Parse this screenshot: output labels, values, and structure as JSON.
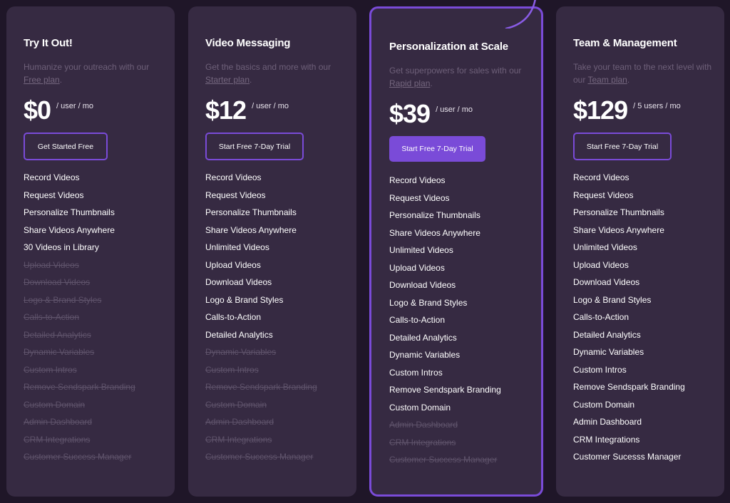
{
  "colors": {
    "background": "#1f1628",
    "card": "#362a42",
    "accent": "#7a4bd8",
    "muted_text": "#6e6079",
    "disabled_text": "#5f536b"
  },
  "plans": [
    {
      "title": "Try It Out!",
      "desc_prefix": "Humanize your outreach with our ",
      "link": "Free plan",
      "desc_suffix": ".",
      "price": "$0",
      "unit": "/ user / mo",
      "button": "Get Started Free",
      "highlighted": false,
      "features": [
        {
          "label": "Record Videos",
          "included": true
        },
        {
          "label": "Request Videos",
          "included": true
        },
        {
          "label": "Personalize Thumbnails",
          "included": true
        },
        {
          "label": "Share Videos Anywhere",
          "included": true
        },
        {
          "label": "30 Videos in Library",
          "included": true
        },
        {
          "label": "Upload Videos",
          "included": false
        },
        {
          "label": "Download Videos",
          "included": false
        },
        {
          "label": "Logo & Brand Styles",
          "included": false
        },
        {
          "label": "Calls-to-Action",
          "included": false
        },
        {
          "label": "Detailed Analytics",
          "included": false
        },
        {
          "label": "Dynamic Variables",
          "included": false
        },
        {
          "label": "Custom Intros",
          "included": false
        },
        {
          "label": "Remove Sendspark Branding",
          "included": false
        },
        {
          "label": "Custom Domain",
          "included": false
        },
        {
          "label": "Admin Dashboard",
          "included": false
        },
        {
          "label": "CRM Integrations",
          "included": false
        },
        {
          "label": "Customer Success Manager",
          "included": false
        }
      ]
    },
    {
      "title": "Video Messaging",
      "desc_prefix": "Get the basics and more with our ",
      "link": "Starter plan",
      "desc_suffix": ".",
      "price": "$12",
      "unit": "/ user / mo",
      "button": "Start Free 7-Day Trial",
      "highlighted": false,
      "features": [
        {
          "label": "Record Videos",
          "included": true
        },
        {
          "label": "Request Videos",
          "included": true
        },
        {
          "label": "Personalize Thumbnails",
          "included": true
        },
        {
          "label": "Share Videos Anywhere",
          "included": true
        },
        {
          "label": "Unlimited Videos",
          "included": true
        },
        {
          "label": "Upload Videos",
          "included": true
        },
        {
          "label": "Download Videos",
          "included": true
        },
        {
          "label": "Logo & Brand Styles",
          "included": true
        },
        {
          "label": "Calls-to-Action",
          "included": true
        },
        {
          "label": "Detailed Analytics",
          "included": true
        },
        {
          "label": "Dynamic Variables",
          "included": false
        },
        {
          "label": "Custom Intros",
          "included": false
        },
        {
          "label": "Remove Sendspark Branding",
          "included": false
        },
        {
          "label": "Custom Domain",
          "included": false
        },
        {
          "label": "Admin Dashboard",
          "included": false
        },
        {
          "label": "CRM Integrations",
          "included": false
        },
        {
          "label": "Customer Success Manager",
          "included": false
        }
      ]
    },
    {
      "title": "Personalization at Scale",
      "desc_prefix": "Get superpowers for sales with our ",
      "link": "Rapid plan",
      "desc_suffix": ".",
      "price": "$39",
      "unit": "/ user / mo",
      "button": "Start Free 7-Day Trial",
      "highlighted": true,
      "features": [
        {
          "label": "Record Videos",
          "included": true
        },
        {
          "label": "Request Videos",
          "included": true
        },
        {
          "label": "Personalize Thumbnails",
          "included": true
        },
        {
          "label": "Share Videos Anywhere",
          "included": true
        },
        {
          "label": "Unlimited Videos",
          "included": true
        },
        {
          "label": "Upload Videos",
          "included": true
        },
        {
          "label": "Download Videos",
          "included": true
        },
        {
          "label": "Logo & Brand Styles",
          "included": true
        },
        {
          "label": "Calls-to-Action",
          "included": true
        },
        {
          "label": "Detailed Analytics",
          "included": true
        },
        {
          "label": "Dynamic Variables",
          "included": true
        },
        {
          "label": "Custom Intros",
          "included": true
        },
        {
          "label": "Remove Sendspark Branding",
          "included": true
        },
        {
          "label": "Custom Domain",
          "included": true
        },
        {
          "label": "Admin Dashboard",
          "included": false
        },
        {
          "label": "CRM Integrations",
          "included": false
        },
        {
          "label": "Customer Success Manager",
          "included": false
        }
      ]
    },
    {
      "title": "Team & Management",
      "desc_prefix": "Take your team to the next level with our ",
      "link": "Team plan",
      "desc_suffix": ".",
      "price": "$129",
      "unit": "/ 5 users / mo",
      "button": "Start Free 7-Day Trial",
      "highlighted": false,
      "features": [
        {
          "label": "Record Videos",
          "included": true
        },
        {
          "label": "Request Videos",
          "included": true
        },
        {
          "label": "Personalize Thumbnails",
          "included": true
        },
        {
          "label": "Share Videos Anywhere",
          "included": true
        },
        {
          "label": "Unlimited Videos",
          "included": true
        },
        {
          "label": "Upload Videos",
          "included": true
        },
        {
          "label": "Download Videos",
          "included": true
        },
        {
          "label": "Logo & Brand Styles",
          "included": true
        },
        {
          "label": "Calls-to-Action",
          "included": true
        },
        {
          "label": "Detailed Analytics",
          "included": true
        },
        {
          "label": "Dynamic Variables",
          "included": true
        },
        {
          "label": "Custom Intros",
          "included": true
        },
        {
          "label": "Remove Sendspark Branding",
          "included": true
        },
        {
          "label": "Custom Domain",
          "included": true
        },
        {
          "label": "Admin Dashboard",
          "included": true
        },
        {
          "label": "CRM Integrations",
          "included": true
        },
        {
          "label": "Customer Sucesss Manager",
          "included": true
        }
      ]
    }
  ]
}
